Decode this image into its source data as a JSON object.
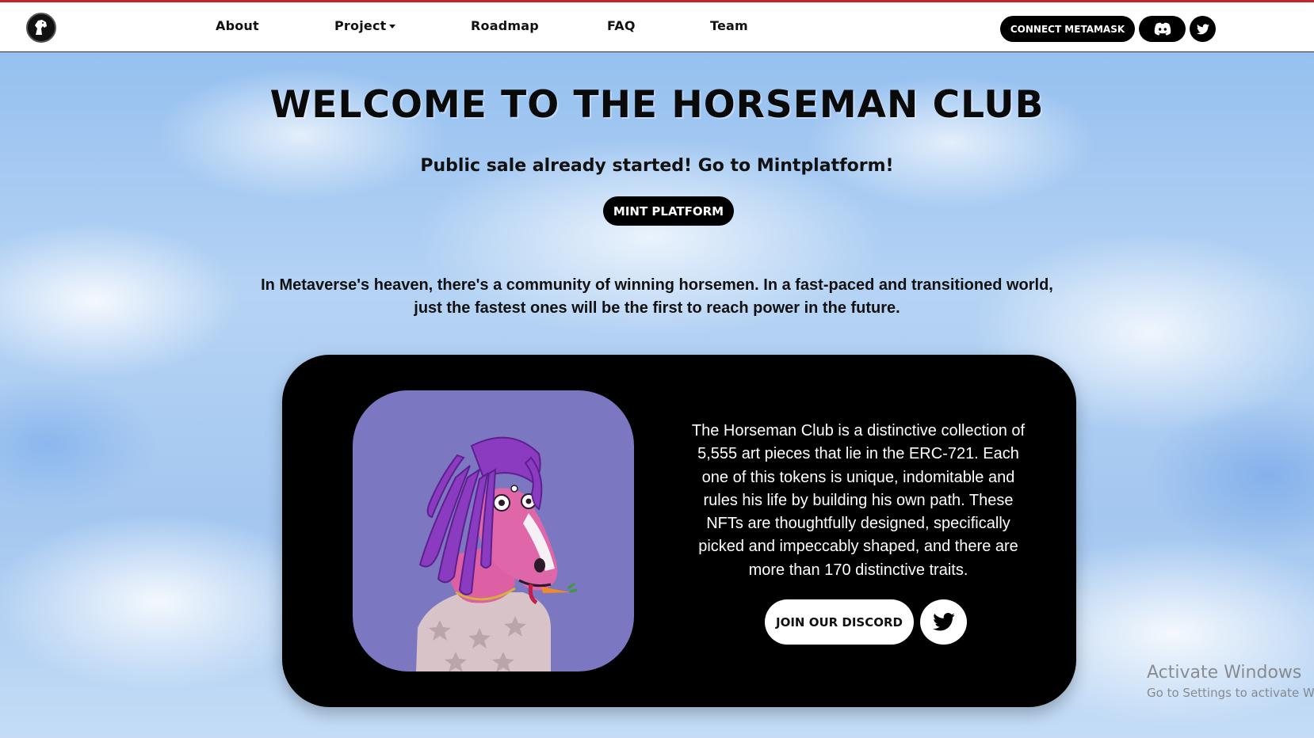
{
  "nav": {
    "links": [
      {
        "label": "About"
      },
      {
        "label": "Project"
      },
      {
        "label": "Roadmap"
      },
      {
        "label": "FAQ"
      },
      {
        "label": "Team"
      }
    ],
    "connect_label": "CONNECT METAMASK",
    "icons": [
      "logo-horse-icon",
      "discord-icon",
      "twitter-icon"
    ]
  },
  "hero": {
    "title": "WELCOME TO THE HORSEMAN CLUB",
    "subtitle": "Public sale already started! Go to Mintplatform!",
    "mint_label": "MINT PLATFORM",
    "intro": "In Metaverse's heaven, there's a community of winning horsemen. In a fast-paced and transitioned world, just the fastest ones will be the first to reach power in the future."
  },
  "card": {
    "description": "The Horseman Club is a distinctive collection of 5,555 art pieces that lie in the ERC-721. Each one of this tokens is unique, indomitable and rules his life by building his own path. These NFTs are thoughtfully designed, specifically picked and impeccably shaped, and there are more than 170 distinctive traits.",
    "join_label": "JOIN OUR DISCORD"
  },
  "watermark": {
    "title": "Activate Windows",
    "subtitle": "Go to Settings to activate Windows."
  },
  "colors": {
    "accent_top": "#c0262d",
    "nft_bg": "#7b77c1",
    "card_bg": "#000000"
  }
}
